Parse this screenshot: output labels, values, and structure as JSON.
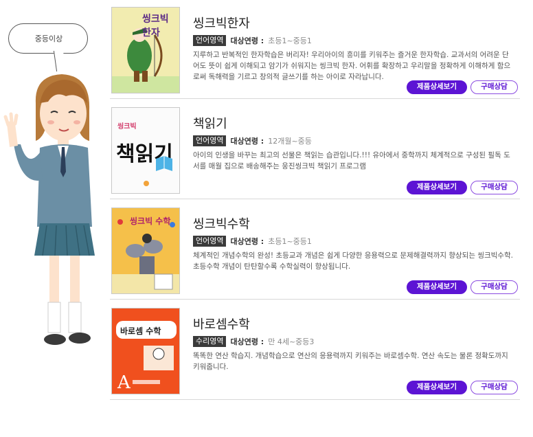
{
  "bubble": {
    "text": "중등이상"
  },
  "colors": {
    "accent": "#5c14d4",
    "badge_bg": "#3a3a3a"
  },
  "products": [
    {
      "title": "씽크빅한자",
      "category": "언어영역",
      "age_label": "대상연령 :",
      "age_value": "초등1~중등1",
      "description": "지루하고 반복적인 한자학습은 버리자! 우리아이의 흥미를 키워주는 즐거운 한자학습. 교과서의 어려운 단어도 뜻이 쉽게 이해되고 암기가 쉬워지는 씽크빅 한자. 어휘를 확장하고 우리말을 정확하게 이해하게 함으로써 독해력을 기르고 창의적 글쓰기를 하는 아이로 자라납니다.",
      "cover_text": "씽크빅 한자",
      "detail_label": "제품상세보기",
      "buy_label": "구매상담"
    },
    {
      "title": "책읽기",
      "category": "언어영역",
      "age_label": "대상연령 :",
      "age_value": "12개월~중등",
      "description": "아이의 인생을 바꾸는 최고의 선물은 책읽는 습관입니다.!!! 유아에서 중학까지 체계적으로 구성된 필독 도서를 매월 집으로  배송해주는 웅진씽크빅 책읽기 프로그램",
      "cover_text": "책읽기",
      "cover_brand": "씽크빅",
      "detail_label": "제품상세보기",
      "buy_label": "구매상담"
    },
    {
      "title": "씽크빅수학",
      "category": "언어영역",
      "age_label": "대상연령 :",
      "age_value": "초등1~중등1",
      "description": "체계적인 개념수학의 완성! 초등교과 개념은 쉽게 다양한 응용력으로 문제해결력까지 향상되는 씽크빅수학. 초등수학 개념이 탄탄할수록 수학실력이 향상됩니다.",
      "cover_text": "씽크빅 수학",
      "detail_label": "제품상세보기",
      "buy_label": "구매상담"
    },
    {
      "title": "바로셈수학",
      "category": "수리영역",
      "age_label": "대상연령 :",
      "age_value": "만 4세~중등3",
      "description": "똑똑한 연산 학습지. 개념학습으로 연산의 응용력까지 키워주는 바로셈수학.  연산 속도는 물론 정확도까지 키워줍니다.",
      "cover_text": "바로셈 수학",
      "detail_label": "제품상세보기",
      "buy_label": "구매상담"
    }
  ]
}
